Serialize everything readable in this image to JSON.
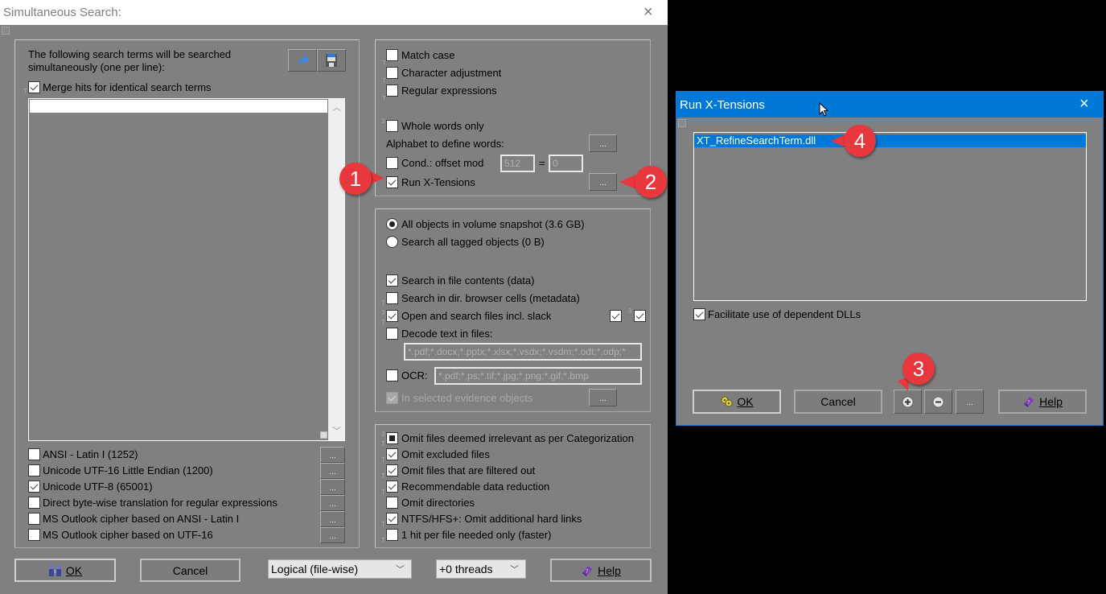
{
  "main_dialog": {
    "title": "Simultaneous Search:",
    "close_label": "×",
    "search_terms": {
      "description_line1": "The following search terms will be searched",
      "description_line2": "simultaneously (one per line):",
      "merge_hits_label": "Merge hits for identical search terms",
      "merge_hits_checked": true,
      "terms_value": "",
      "load_icon": "open-arrow-icon",
      "save_icon": "floppy-disk-icon"
    },
    "code_pages": [
      {
        "label": "ANSI - Latin I (1252)",
        "checked": false,
        "button": "..."
      },
      {
        "label": "Unicode UTF-16 Little Endian (1200)",
        "checked": false,
        "button": "..."
      },
      {
        "label": "Unicode UTF-8 (65001)",
        "checked": true,
        "button": "..."
      },
      {
        "label": "Direct byte-wise translation for regular expressions",
        "checked": false,
        "button": "..."
      },
      {
        "label": "MS Outlook cipher based on ANSI - Latin I",
        "checked": false,
        "button": "..."
      },
      {
        "label": "MS Outlook cipher based on UTF-16",
        "checked": false,
        "button": "..."
      }
    ],
    "options": {
      "match_case": "Match case",
      "character_adjustment": "Character adjustment",
      "regular_expressions": "Regular expressions",
      "whole_words_only": "Whole words only",
      "alphabet_label": "Alphabet to define words:",
      "alphabet_button": "...",
      "cond_offset_label": "Cond.: offset mod",
      "cond_offset_mod": "512",
      "equals": "=",
      "cond_offset_value": "0",
      "run_xtensions": "Run X-Tensions",
      "run_xtensions_checked": true,
      "run_xtensions_button": "..."
    },
    "scope": {
      "all_objects": "All objects in volume snapshot (3.6 GB)",
      "tagged_objects": "Search all tagged objects (0 B)",
      "selected": "all_objects",
      "search_file_contents": "Search in file contents (data)",
      "search_dir_browser": "Search in dir. browser cells (metadata)",
      "open_search_slack": "Open and search files incl. slack",
      "decode_text": "Decode text in files:",
      "decode_text_value": "*.pdf;*.docx;*.pptx;*.xlsx;*.vsdx;*.vsdm;*.odt;*.odp;*",
      "ocr_label": "OCR:",
      "ocr_value": "*.pdf;*.ps;*.tif;*.jpg;*.png;*.gif;*.bmp",
      "in_selected_evidence": "In selected evidence objects",
      "evidence_button": "..."
    },
    "omit": [
      {
        "label": "Omit files deemed irrelevant as per Categorization",
        "state": "indeterminate"
      },
      {
        "label": "Omit excluded files",
        "state": "checked"
      },
      {
        "label": "Omit files that are filtered out",
        "state": "checked"
      },
      {
        "label": "Recommendable data reduction",
        "state": "checked"
      },
      {
        "label": "Omit directories",
        "state": "unchecked"
      },
      {
        "label": "NTFS/HFS+: Omit additional hard links",
        "state": "checked"
      },
      {
        "label": "1 hit per file needed only (faster)",
        "state": "unchecked"
      }
    ],
    "footer": {
      "ok_label": "OK",
      "ok_mnemonic": "O",
      "cancel_label": "Cancel",
      "mode_select": "Logical (file-wise)",
      "threads_select": "+0 threads",
      "help_label": "Help"
    }
  },
  "xtensions_dialog": {
    "title": "Run X-Tensions",
    "close_label": "×",
    "items": [
      "XT_RefineSearchTerm.dll"
    ],
    "selected_index": 0,
    "facilitate_label": "Facilitate use of dependent DLLs",
    "facilitate_checked": true,
    "ok_label": "OK",
    "cancel_label": "Cancel",
    "add_icon": "plus-circle-icon",
    "remove_icon": "minus-circle-icon",
    "more_label": "...",
    "help_label": "Help"
  },
  "callouts": [
    "1",
    "2",
    "3",
    "4"
  ],
  "colors": {
    "dialog_bg": "#808080",
    "title_active": "#0078d7",
    "callout": "#e8383d",
    "selection": "#0078d7"
  }
}
